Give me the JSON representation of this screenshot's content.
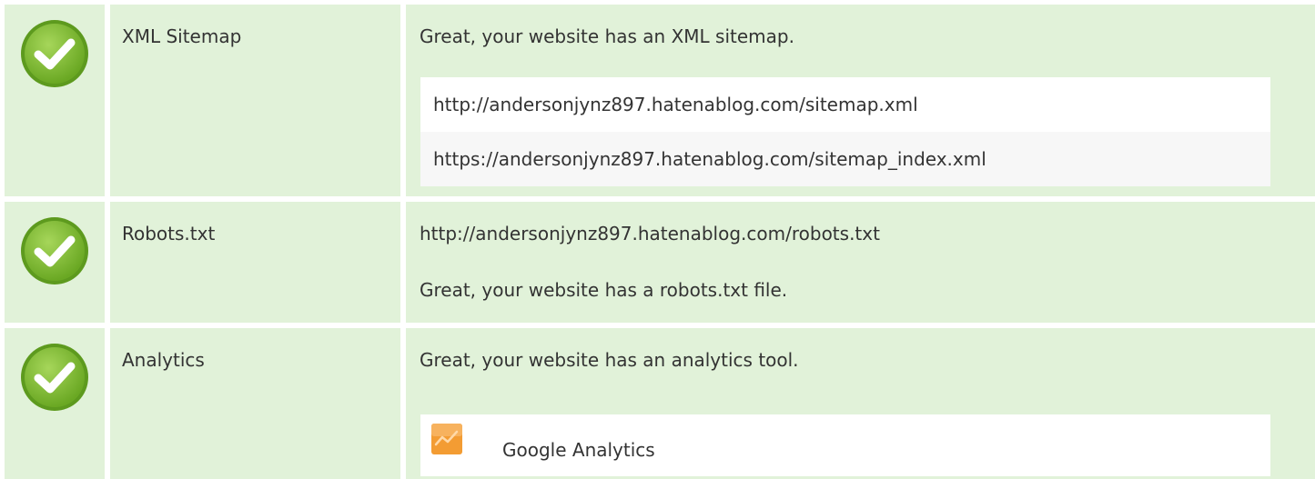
{
  "checks": {
    "sitemap": {
      "label": "XML Sitemap",
      "status": "pass",
      "message": "Great, your website has an XML sitemap.",
      "urls": [
        "http://andersonjynz897.hatenablog.com/sitemap.xml",
        "https://andersonjynz897.hatenablog.com/sitemap_index.xml"
      ]
    },
    "robots": {
      "label": "Robots.txt",
      "status": "pass",
      "url": "http://andersonjynz897.hatenablog.com/robots.txt",
      "message": "Great, your website has a robots.txt file."
    },
    "analytics": {
      "label": "Analytics",
      "status": "pass",
      "message": "Great, your website has an analytics tool.",
      "tools": [
        {
          "name": "Google Analytics",
          "icon": "google-analytics-icon"
        }
      ]
    }
  },
  "icons": {
    "status_pass": "check-circle-icon"
  },
  "colors": {
    "row_background": "#e1f2d9",
    "check_green": "#7cb82f",
    "check_green_dark": "#5d9a1e",
    "analytics_orange": "#f39c33"
  }
}
